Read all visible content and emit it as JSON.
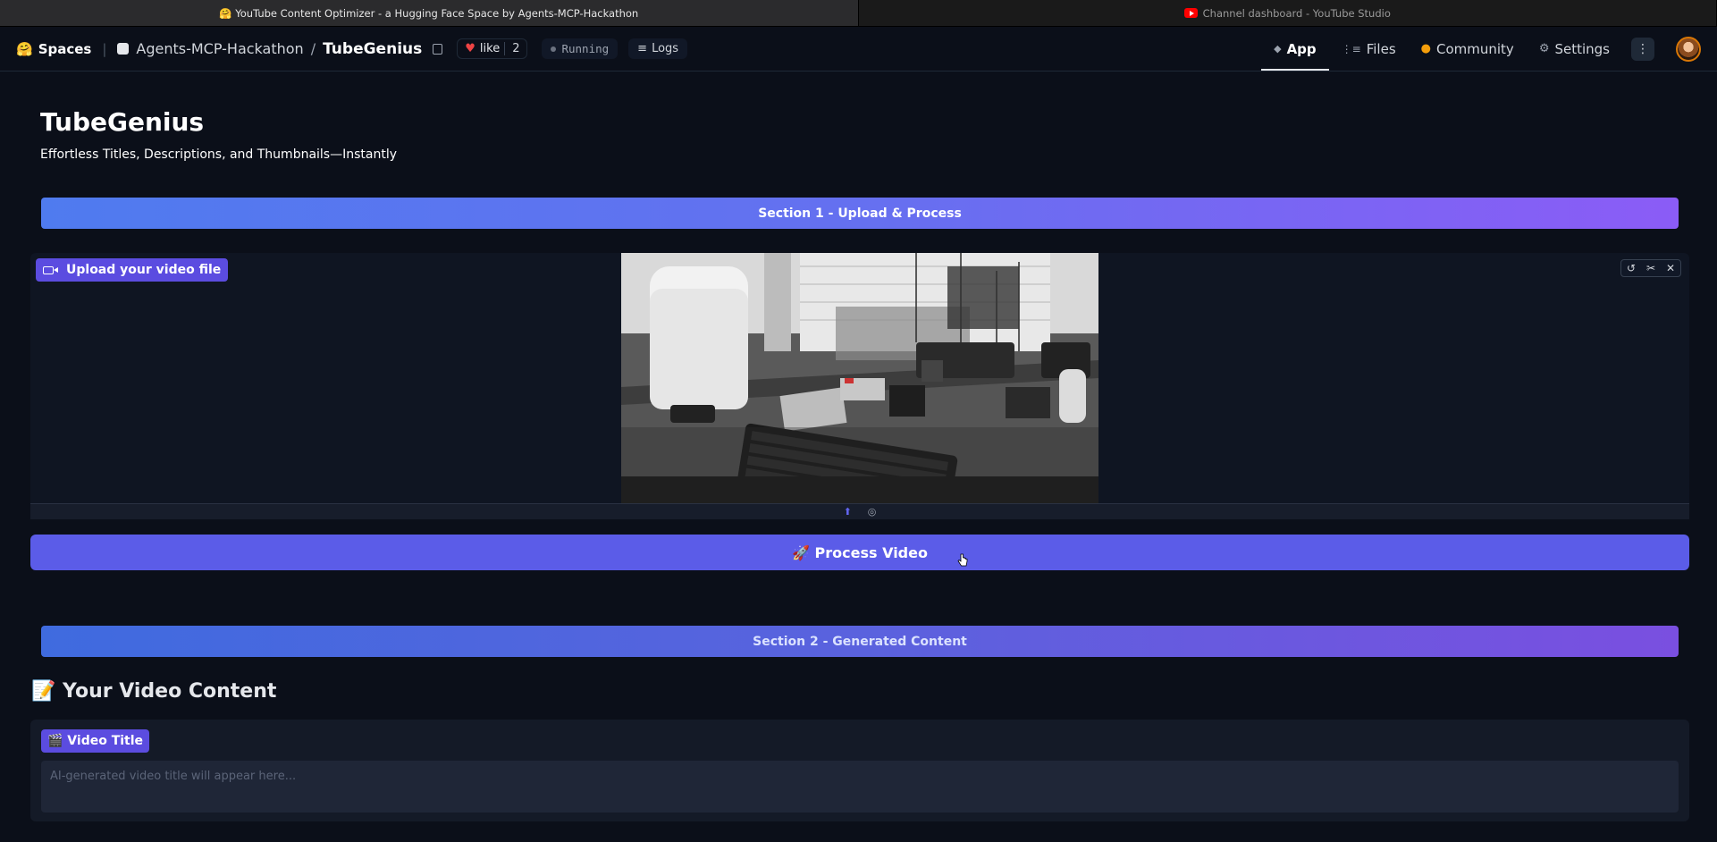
{
  "browser": {
    "tabs": [
      {
        "label": "🤗 YouTube Content Optimizer - a Hugging Face Space by Agents-MCP-Hackathon",
        "active": true
      },
      {
        "label": "Channel dashboard - YouTube Studio",
        "active": false,
        "icon": "youtube-icon"
      }
    ]
  },
  "hf_header": {
    "logo": "🤗",
    "spaces_label": "Spaces",
    "org": "Agents-MCP-Hackathon",
    "slash": "/",
    "space_name": "TubeGenius",
    "like_label": "like",
    "like_count": "2",
    "status": "Running",
    "logs_label": "Logs",
    "nav": [
      {
        "label": "App",
        "icon": "app-icon",
        "active": true
      },
      {
        "label": "Files",
        "icon": "files-icon",
        "active": false
      },
      {
        "label": "Community",
        "icon": "community-icon",
        "active": false
      },
      {
        "label": "Settings",
        "icon": "gear-icon",
        "active": false
      }
    ],
    "more_icon": "⋮"
  },
  "app": {
    "title": "TubeGenius",
    "subtitle": "Effortless Titles, Descriptions, and Thumbnails—Instantly",
    "section1": "Section 1 - Upload & Process",
    "video_label": "Upload your video file",
    "process_button": "🚀 Process Video",
    "section2": "Section 2 - Generated Content",
    "content_heading": "📝 Your Video Content",
    "video_title_label": "🎬 Video Title",
    "video_title_placeholder": "AI-generated video title will appear here...",
    "video_title_value": ""
  },
  "colors": {
    "background": "#0b0f19",
    "accent": "#5b5ce8",
    "label_bg": "#5b4ce0",
    "banner_start": "#4f7bef",
    "banner_end": "#8b5cf6"
  }
}
